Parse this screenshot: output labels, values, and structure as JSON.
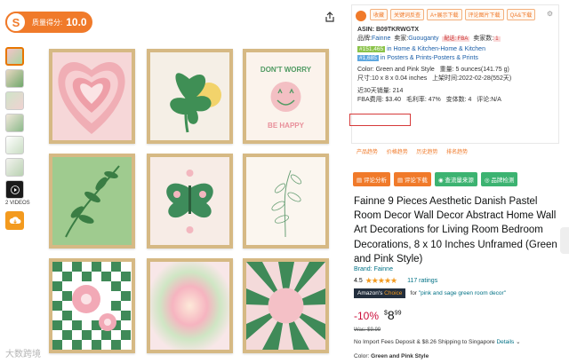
{
  "quality": {
    "logo": "S",
    "label": "质量得分:",
    "score": "10.0"
  },
  "thumbs": {
    "video_label": "2 VIDEOS"
  },
  "tool": {
    "buttons": [
      "收藏",
      "关键词反查",
      "A+展示下载",
      "评论图片下载",
      "QA&下载"
    ],
    "asin": "ASIN: B09TKRWGTX",
    "brand_label": "品牌:",
    "brand": "Fainne",
    "seller_label": "卖家:",
    "seller": "Guouganty",
    "fba_tag": "配送: FBA",
    "sellers_label": "卖家数:",
    "sellers": "1",
    "rank1": "#151,465",
    "rank1_cat": "in Home & Kitchen-Home & Kitchen",
    "rank2": "#1,685",
    "rank2_cat": "in Posters & Prints-Posters & Prints",
    "color_line": "Color: Green and Pink Style",
    "weight_label": "重量:",
    "weight": "5 ounces(141.75 g)",
    "size_label": "尺寸:",
    "size": "10 x 8 x 0.04 inches",
    "launch_label": "上架时间:",
    "launch": "2022-02-28(552天)",
    "sales30": "近30天销量: 214",
    "fba_fee": "FBA费用: $3.40",
    "margin": "毛利率: 47%",
    "variants": "变体数: 4",
    "reviews": "评论:N/A",
    "links": [
      "产品趋势",
      "价格趋势",
      "历史趋势",
      "排名趋势"
    ],
    "actions": [
      {
        "label": "评论分析",
        "color": "#f07a2a"
      },
      {
        "label": "评论下载",
        "color": "#f07a2a"
      },
      {
        "label": "查流量来源",
        "color": "#3cb371"
      },
      {
        "label": "品牌检测",
        "color": "#3cb371"
      }
    ]
  },
  "product": {
    "title": "Fainne 9 Pieces Aesthetic Danish Pastel Room Decor Wall Decor Abstract Home Wall Art Decorations for Living Room Bedroom Decorations, 8 x 10 Inches Unframed (Green and Pink Style)",
    "brand": "Brand: Fainne",
    "rating": "4.5",
    "stars": "★★★★★",
    "ratings_count": "117 ratings",
    "choice_1": "Amazon's ",
    "choice_2": "Choice",
    "choice_for": "for",
    "choice_query": "\"pink and sage green room decor\"",
    "discount": "-10%",
    "price_symbol": "$",
    "price_whole": "8",
    "price_frac": "99",
    "was": "Was: $9.99",
    "shipping": "No Import Fees Deposit & $8.26 Shipping to Singapore",
    "details": "Details",
    "color_label": "Color:",
    "color_value": "Green and Pink Style"
  },
  "poster_texts": {
    "dont_worry": "DON'T WORRY",
    "be_happy": "BE HAPPY"
  },
  "watermark": "大数跨境"
}
